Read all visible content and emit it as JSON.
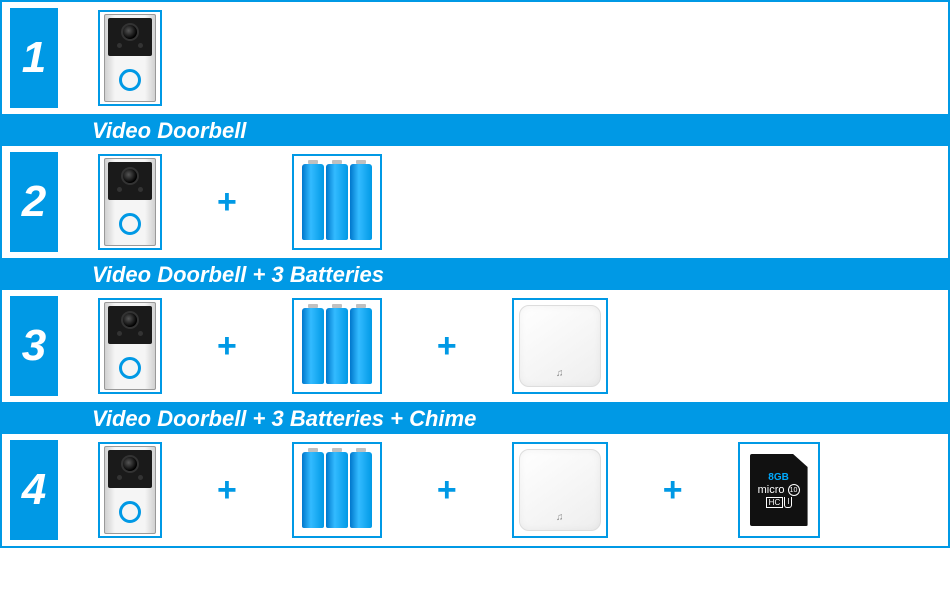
{
  "options": [
    {
      "num": "1",
      "items": [
        "doorbell"
      ],
      "label": "Video Doorbell"
    },
    {
      "num": "2",
      "items": [
        "doorbell",
        "batteries"
      ],
      "label": "Video Doorbell + 3 Batteries"
    },
    {
      "num": "3",
      "items": [
        "doorbell",
        "batteries",
        "chime"
      ],
      "label": "Video Doorbell + 3 Batteries + Chime"
    },
    {
      "num": "4",
      "items": [
        "doorbell",
        "batteries",
        "chime",
        "sdcard"
      ],
      "label": ""
    }
  ],
  "plus": "+",
  "sdcard": {
    "capacity": "8GB",
    "line1": "micro",
    "hc": "HC",
    "c10": "⑩",
    "u1": "I"
  },
  "chime_note": "♫"
}
